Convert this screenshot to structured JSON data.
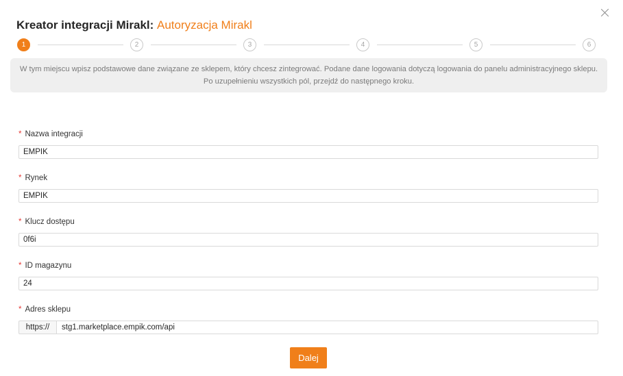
{
  "dialog": {
    "title_prefix": "Kreator integracji Mirakl:",
    "title_accent": "Autoryzacja Mirakl"
  },
  "steps": [
    "1",
    "2",
    "3",
    "4",
    "5",
    "6"
  ],
  "active_step": 1,
  "info_text": "W tym miejscu wpisz podstawowe dane związane ze sklepem, który chcesz zintegrować. Podane dane logowania dotyczą logowania do panelu administracyjnego sklepu. Po uzupełnieniu wszystkich pól, przejdź do następnego kroku.",
  "form": {
    "required_mark": "*",
    "integration_name": {
      "label": "Nazwa integracji",
      "value": "EMPIK"
    },
    "market": {
      "label": "Rynek",
      "value": "EMPIK"
    },
    "access_key": {
      "label": "Klucz dostępu",
      "value": "0f6i"
    },
    "warehouse_id": {
      "label": "ID magazynu",
      "value": "24"
    },
    "shop_address": {
      "label": "Adres sklepu",
      "prefix": "https://",
      "value": "stg1.marketplace.empik.com/api"
    }
  },
  "buttons": {
    "next": "Dalej"
  },
  "colors": {
    "accent": "#f07f1a",
    "required": "#e53935"
  },
  "icons": {
    "close": "close-icon"
  }
}
